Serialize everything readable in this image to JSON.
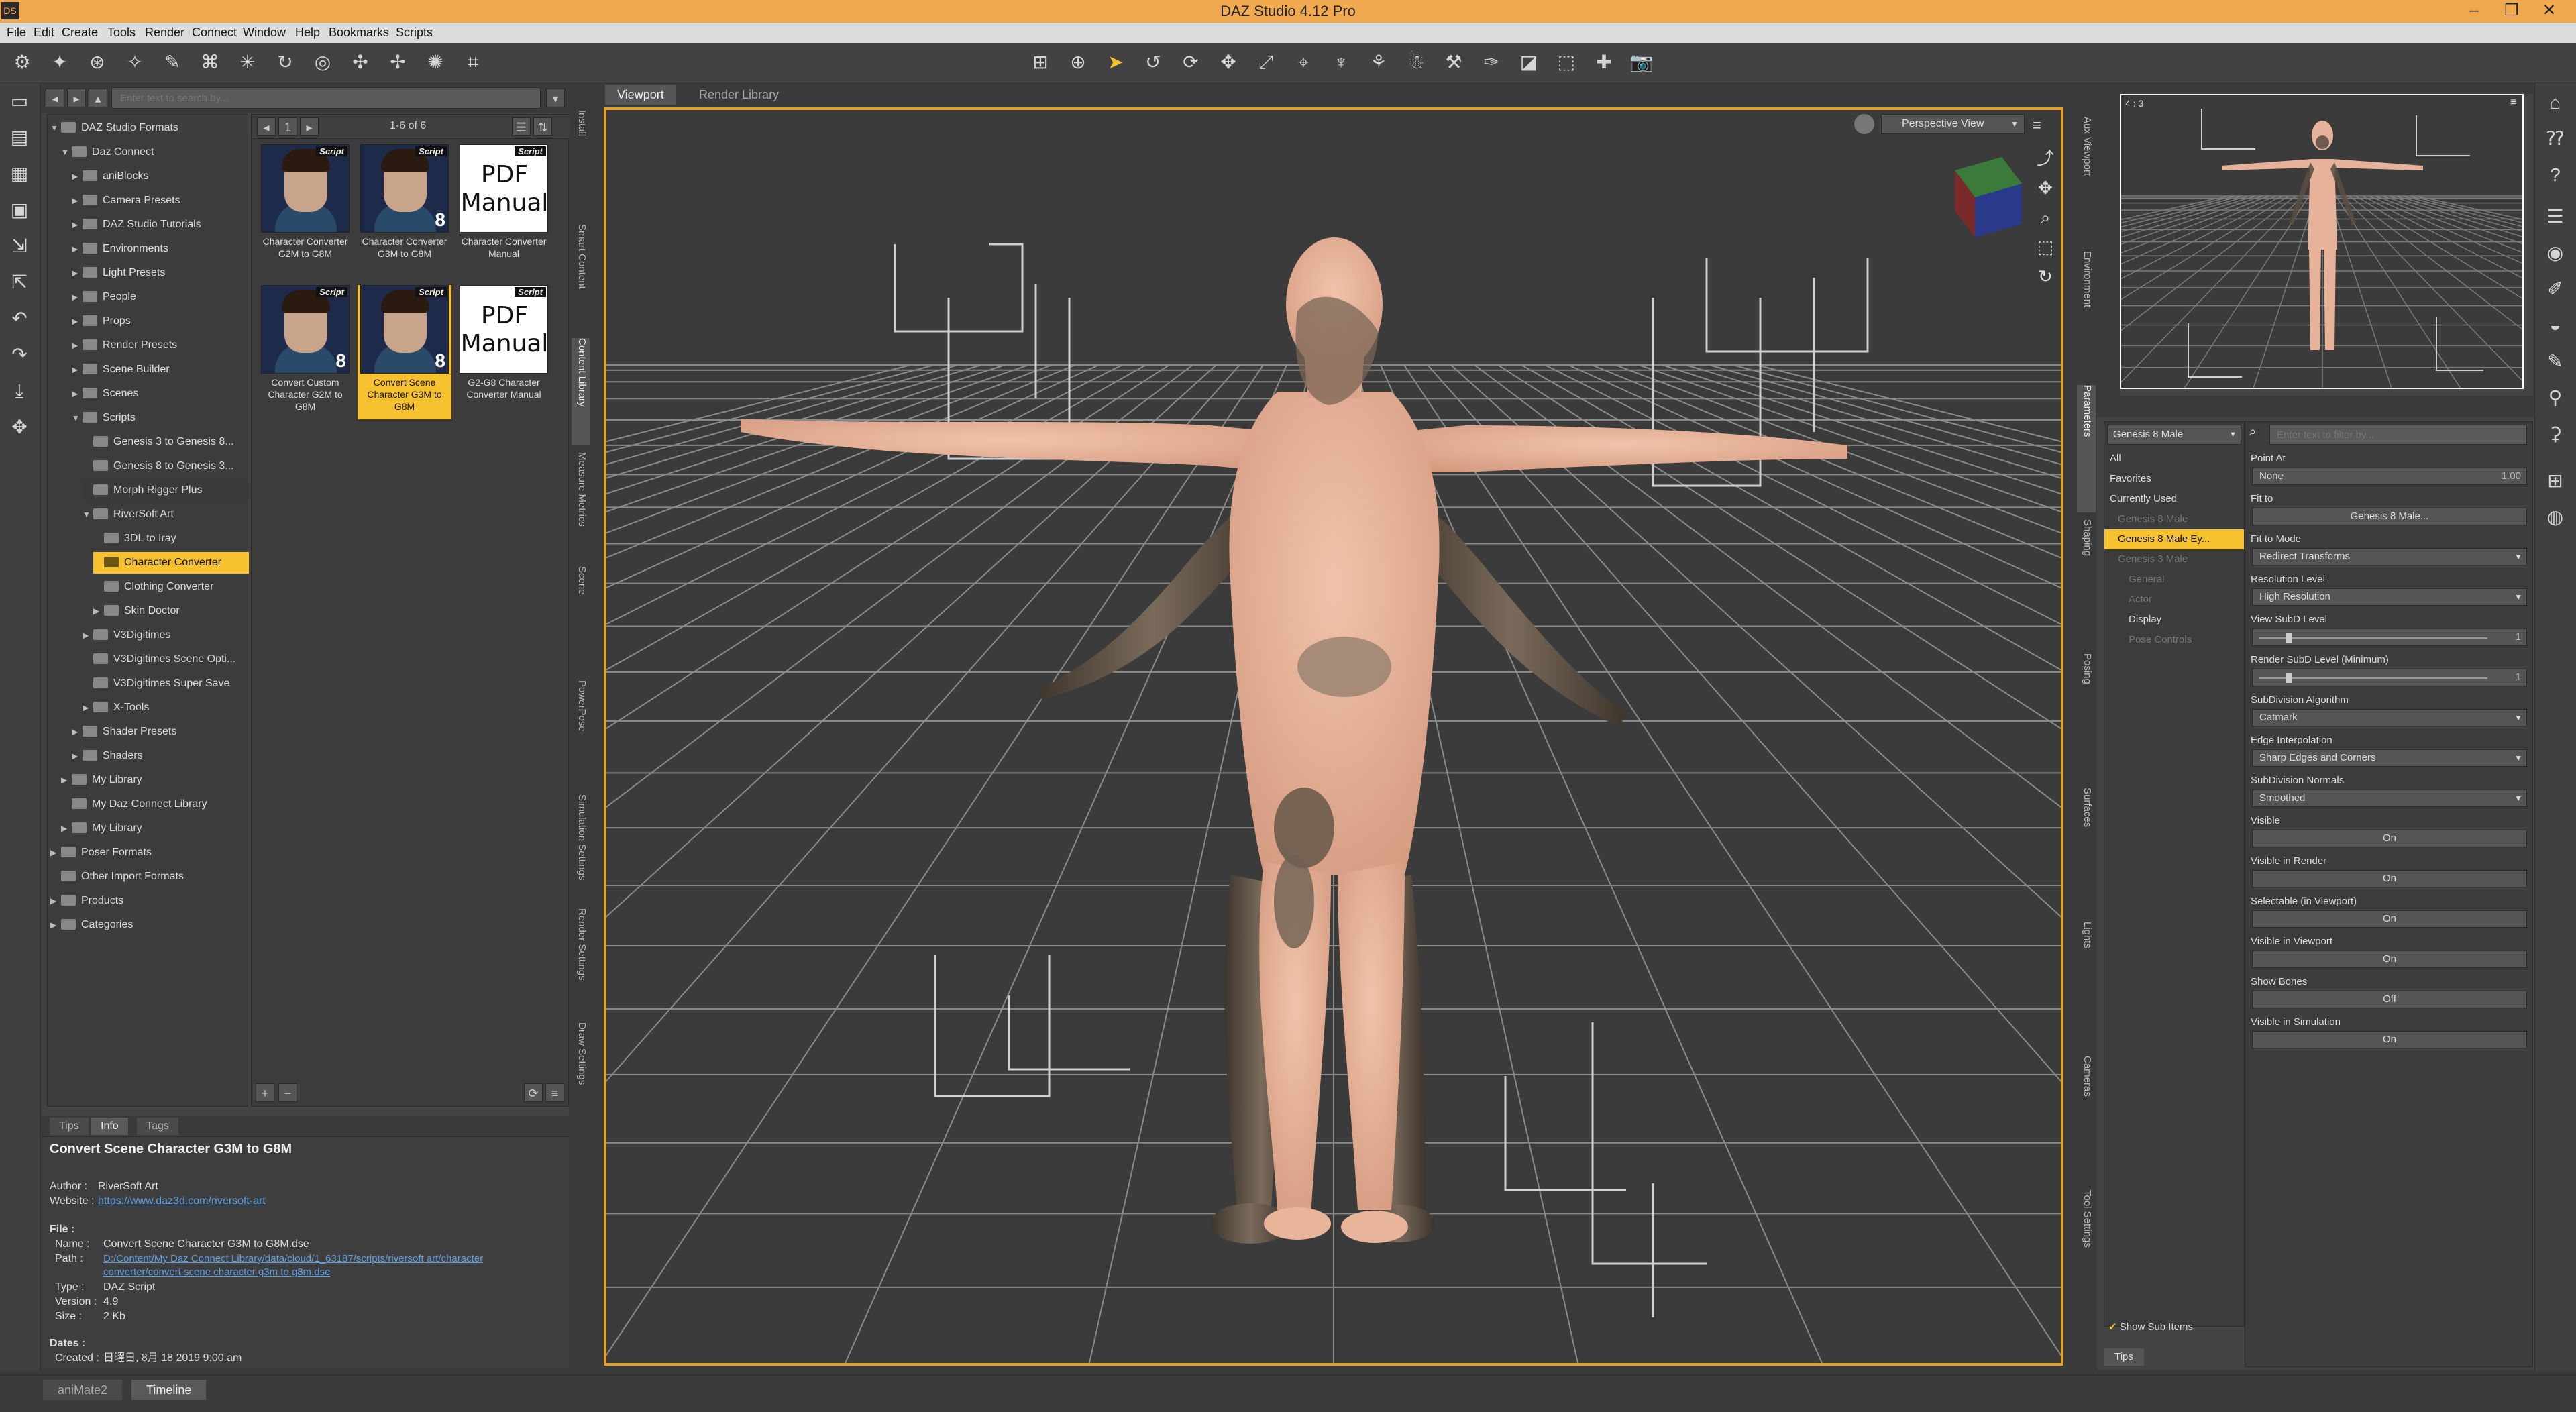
{
  "app": {
    "title": "DAZ Studio 4.12 Pro",
    "icon_label": "DS"
  },
  "menu": [
    "File",
    "Edit",
    "Create",
    "Tools",
    "Render",
    "Connect",
    "Window",
    "Help",
    "Bookmarks",
    "Scripts"
  ],
  "content_library": {
    "search_placeholder": "Enter text to search by...",
    "page_info": "1-6 of 6",
    "tree": [
      {
        "label": "DAZ Studio Formats",
        "level": 0,
        "expanded": true
      },
      {
        "label": "Daz Connect",
        "level": 1,
        "expanded": true
      },
      {
        "label": "aniBlocks",
        "level": 2
      },
      {
        "label": "Camera Presets",
        "level": 2
      },
      {
        "label": "DAZ Studio Tutorials",
        "level": 2
      },
      {
        "label": "Environments",
        "level": 2
      },
      {
        "label": "Light Presets",
        "level": 2
      },
      {
        "label": "People",
        "level": 2
      },
      {
        "label": "Props",
        "level": 2
      },
      {
        "label": "Render Presets",
        "level": 2
      },
      {
        "label": "Scene Builder",
        "level": 2
      },
      {
        "label": "Scenes",
        "level": 2
      },
      {
        "label": "Scripts",
        "level": 2,
        "expanded": true
      },
      {
        "label": "Genesis 3 to Genesis 8...",
        "level": 3,
        "leaf": true
      },
      {
        "label": "Genesis 8 to Genesis 3...",
        "level": 3,
        "leaf": true
      },
      {
        "label": "Morph Rigger Plus",
        "level": 3,
        "leaf": true,
        "highlight": true
      },
      {
        "label": "RiverSoft Art",
        "level": 3,
        "expanded": true
      },
      {
        "label": "3DL to Iray",
        "level": 4,
        "leaf": true
      },
      {
        "label": "Character Converter",
        "level": 4,
        "leaf": true,
        "selected": true
      },
      {
        "label": "Clothing Converter",
        "level": 4,
        "leaf": true
      },
      {
        "label": "Skin Doctor",
        "level": 4
      },
      {
        "label": "V3Digitimes",
        "level": 3
      },
      {
        "label": "V3Digitimes Scene Opti...",
        "level": 3,
        "leaf": true
      },
      {
        "label": "V3Digitimes Super Save",
        "level": 3,
        "leaf": true
      },
      {
        "label": "X-Tools",
        "level": 3
      },
      {
        "label": "Shader Presets",
        "level": 2
      },
      {
        "label": "Shaders",
        "level": 2
      },
      {
        "label": "My Library",
        "level": 1
      },
      {
        "label": "My Daz Connect Library",
        "level": 1,
        "leaf": true
      },
      {
        "label": "My Library",
        "level": 1
      },
      {
        "label": "Poser Formats",
        "level": 0
      },
      {
        "label": "Other Import Formats",
        "level": 0,
        "leaf": true
      },
      {
        "label": "Products",
        "level": 0
      },
      {
        "label": "Categories",
        "level": 0
      }
    ],
    "assets": [
      {
        "caption": "Character Converter G2M to G8M",
        "badge": "Script",
        "kind": "face",
        "num": ""
      },
      {
        "caption": "Character Converter G3M to G8M",
        "badge": "Script",
        "kind": "face",
        "num": "8"
      },
      {
        "caption": "Character Converter Manual",
        "badge": "Script",
        "kind": "pdf",
        "num": ""
      },
      {
        "caption": "Convert Custom Character G2M to G8M",
        "badge": "Script",
        "kind": "face",
        "num": "8"
      },
      {
        "caption": "Convert Scene Character G3M to G8M",
        "badge": "Script",
        "kind": "face",
        "num": "8",
        "selected": true
      },
      {
        "caption": "G2-G8 Character Converter Manual",
        "badge": "Script",
        "kind": "pdf",
        "num": ""
      }
    ],
    "pdf_text": "PDF\nManual"
  },
  "side_tabs_left": [
    "Install",
    "Smart Content",
    "Content Library",
    "Measure Metrics",
    "Scene",
    "PowerPose",
    "Simulation Settings",
    "Render Settings",
    "Draw Settings"
  ],
  "info": {
    "tabs": [
      "Tips",
      "Info",
      "Tags"
    ],
    "active_tab": "Info",
    "title": "Convert Scene Character G3M to G8M",
    "author_label": "Author :",
    "author": "RiverSoft Art",
    "website_label": "Website :",
    "website": "https://www.daz3d.com/riversoft-art",
    "file_label": "File :",
    "name_label": "Name :",
    "name": "Convert Scene Character G3M to G8M.dse",
    "path_label": "Path :",
    "path1": "D:/Content/My Daz Connect Library/data/cloud/1_63187/scripts/riversoft art/character",
    "path2": "converter/convert scene character g3m to g8m.dse",
    "type_label": "Type :",
    "type": "DAZ Script",
    "version_label": "Version :",
    "version": "4.9",
    "size_label": "Size :",
    "size": "2 Kb",
    "dates_label": "Dates :",
    "created_label": "Created :",
    "created": "日曜日, 8月 18 2019 9:00 am"
  },
  "viewport": {
    "tabs": [
      "Viewport",
      "Render Library"
    ],
    "active_tab": "Viewport",
    "view": "Perspective View",
    "aux_ratio": "4 : 3"
  },
  "side_tabs_right": [
    "Aux Viewport",
    "Environment",
    "Parameters",
    "Shaping",
    "Posing",
    "Surfaces",
    "Lights",
    "Cameras",
    "Tool Settings"
  ],
  "scene": {
    "selector": "Genesis 8 Male",
    "filter_placeholder": "Enter text to filter by...",
    "items": [
      {
        "label": "All"
      },
      {
        "label": "Favorites"
      },
      {
        "label": "Currently Used"
      },
      {
        "label": "Genesis 8 Male",
        "dim": true
      },
      {
        "label": "Genesis 8 Male Ey...",
        "selected": true
      },
      {
        "label": "Genesis 3 Male",
        "dim": true
      },
      {
        "label": "General",
        "dim": true
      },
      {
        "label": "Actor",
        "dim": true
      },
      {
        "label": "Display"
      },
      {
        "label": "Pose Controls",
        "dim": true
      }
    ],
    "show_sub_items": "Show Sub Items",
    "tips": "Tips"
  },
  "properties": [
    {
      "label": "Point At",
      "value": "None",
      "extra": "1.00"
    },
    {
      "label": "Fit to",
      "value": "Genesis 8 Male...",
      "center": true
    },
    {
      "label": "Fit to Mode",
      "value": "Redirect Transforms",
      "dd": true
    },
    {
      "label": "Resolution Level",
      "value": "High Resolution",
      "dd": true
    },
    {
      "label": "View SubD Level",
      "value": "",
      "slider": true,
      "extra": "1"
    },
    {
      "label": "Render SubD Level (Minimum)",
      "value": "",
      "slider": true,
      "extra": "1"
    },
    {
      "label": "SubDivision Algorithm",
      "value": "Catmark",
      "dd": true
    },
    {
      "label": "Edge Interpolation",
      "value": "Sharp Edges and Corners",
      "dd": true
    },
    {
      "label": "SubDivision Normals",
      "value": "Smoothed",
      "dd": true
    },
    {
      "label": "Visible",
      "value": "On",
      "center": true
    },
    {
      "label": "Visible in Render",
      "value": "On",
      "center": true
    },
    {
      "label": "Selectable (in Viewport)",
      "value": "On",
      "center": true
    },
    {
      "label": "Visible in Viewport",
      "value": "On",
      "center": true
    },
    {
      "label": "Show Bones",
      "value": "Off",
      "center": true
    },
    {
      "label": "Visible in Simulation",
      "value": "On",
      "center": true
    }
  ],
  "bottom_tabs": [
    "aniMate2",
    "Timeline"
  ],
  "bottom_active": "Timeline",
  "colors": {
    "accent": "#f6c12e",
    "title_bar": "#f0a94e",
    "viewport_border": "#e0a030",
    "skin": "#e8b49a",
    "dark_skin": "#5a4e42"
  }
}
